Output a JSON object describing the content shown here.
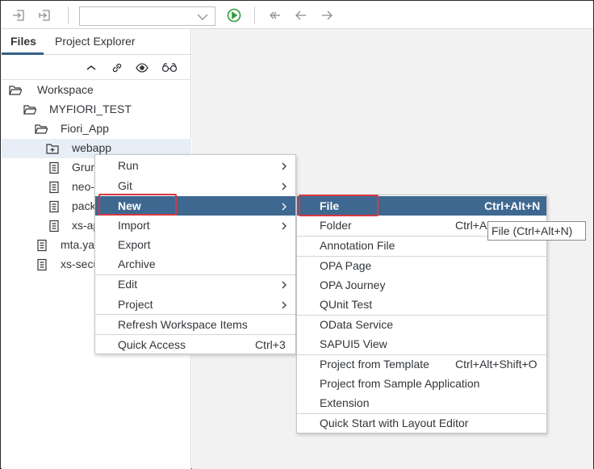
{
  "toolbar": {
    "icons": [
      "import-icon",
      "export-icon",
      "run-icon",
      "back-to-start-icon",
      "back-icon",
      "forward-icon"
    ],
    "select_value": "",
    "run_color": "#2f9a41"
  },
  "left_pane": {
    "tabs": [
      {
        "label": "Files",
        "active": true
      },
      {
        "label": "Project Explorer",
        "active": false
      }
    ],
    "tools": [
      "collapse-icon",
      "link-icon",
      "show-hidden-icon",
      "glasses-icon"
    ]
  },
  "tree": [
    {
      "label": "Workspace",
      "icon": "folder-open-icon",
      "depth": 0
    },
    {
      "label": "MYFIORI_TEST",
      "icon": "folder-open-icon",
      "depth": 1
    },
    {
      "label": "Fiori_App",
      "icon": "folder-open-icon",
      "depth": 2
    },
    {
      "label": "webapp",
      "icon": "folder-plus-icon",
      "depth": 3,
      "selected": true
    },
    {
      "label": "Grun",
      "icon": "file-icon",
      "depth": 3
    },
    {
      "label": "neo-",
      "icon": "file-icon",
      "depth": 3
    },
    {
      "label": "pack",
      "icon": "file-icon",
      "depth": 3
    },
    {
      "label": "xs-ap",
      "icon": "file-icon",
      "depth": 3
    },
    {
      "label": "mta.ya",
      "icon": "file-icon",
      "depth": 2
    },
    {
      "label": "xs-secu",
      "icon": "file-icon",
      "depth": 2
    }
  ],
  "context_menu": {
    "items": [
      {
        "label": "Run",
        "submenu": true
      },
      {
        "label": "Git",
        "submenu": true
      },
      {
        "label": "New",
        "submenu": true,
        "highlighted": true
      },
      {
        "label": "Import",
        "submenu": true
      },
      {
        "label": "Export"
      },
      {
        "label": "Archive"
      },
      {
        "label": "Edit",
        "submenu": true
      },
      {
        "label": "Project",
        "submenu": true
      },
      {
        "label": "Refresh Workspace Items"
      },
      {
        "label": "Quick Access",
        "shortcut": "Ctrl+3"
      }
    ]
  },
  "submenu": {
    "items": [
      {
        "label": "File",
        "shortcut": "Ctrl+Alt+N",
        "highlighted": true
      },
      {
        "label": "Folder",
        "shortcut": "Ctrl+A"
      },
      {
        "label": "Annotation File"
      },
      {
        "label": "OPA Page"
      },
      {
        "label": "OPA Journey"
      },
      {
        "label": "QUnit Test"
      },
      {
        "label": "OData Service"
      },
      {
        "label": "SAPUI5 View"
      },
      {
        "label": "Project from Template",
        "shortcut": "Ctrl+Alt+Shift+O"
      },
      {
        "label": "Project from Sample Application"
      },
      {
        "label": "Extension"
      },
      {
        "label": "Quick Start with Layout Editor"
      }
    ]
  },
  "tooltip": "File (Ctrl+Alt+N)",
  "colors": {
    "menu_highlight": "#3f6891",
    "annotation_box": "#d9383f",
    "selection": "#e8eef5"
  }
}
